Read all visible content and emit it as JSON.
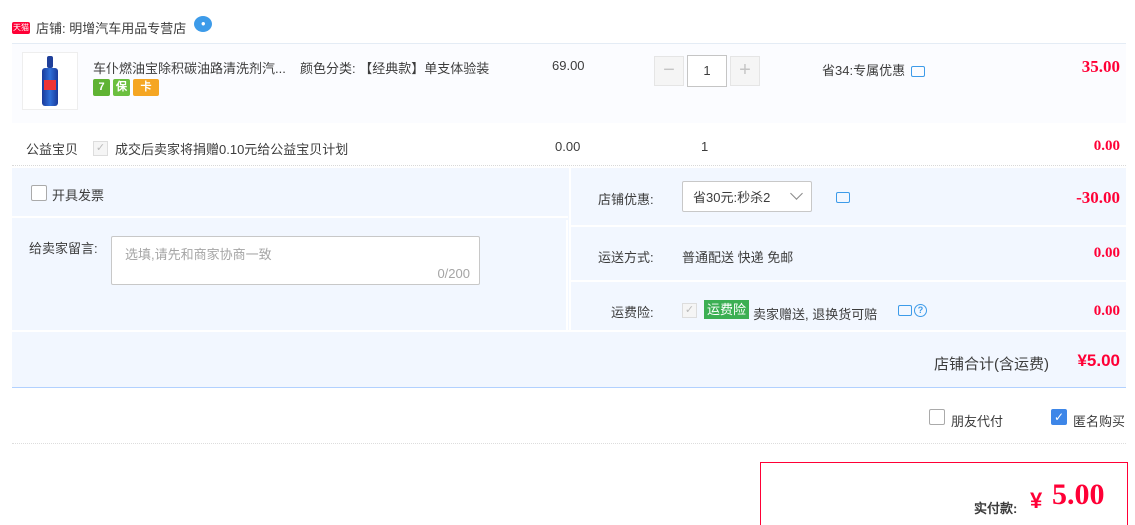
{
  "shop": {
    "badge": "天猫",
    "name": "店铺: 明增汽车用品专营店"
  },
  "item": {
    "title": "车仆燃油宝除积碳油路清洗剂汽...",
    "sku": "颜色分类: 【经典款】单支体验装",
    "tags": [
      "7",
      "保",
      "卡"
    ],
    "unit_price": "69.00",
    "qty": "1",
    "minus": "−",
    "plus": "+",
    "discount": "省34:专属优惠",
    "total": "35.00"
  },
  "charity": {
    "label": "公益宝贝",
    "text": "成交后卖家将捐赠0.10元给公益宝贝计划",
    "price": "0.00",
    "qty": "1",
    "total": "0.00"
  },
  "invoice": {
    "label": "开具发票"
  },
  "memo": {
    "label": "给卖家留言:",
    "placeholder": "选填,请先和商家协商一致",
    "count": "0/200"
  },
  "shop_discount": {
    "label": "店铺优惠:",
    "selected": "省30元:秒杀2",
    "amount": "-30.00"
  },
  "shipping": {
    "label": "运送方式:",
    "value": "普通配送 快递 免邮",
    "amount": "0.00"
  },
  "insurance": {
    "label": "运费险:",
    "badge": "运费险",
    "text": "卖家赠送, 退换货可赔",
    "amount": "0.00"
  },
  "shop_total": {
    "label": "店铺合计(含运费)",
    "amount": "¥5.00"
  },
  "options": {
    "proxy": "朋友代付",
    "anon": "匿名购买"
  },
  "pay": {
    "label": "实付款:",
    "currency": "¥",
    "amount": "5.00"
  },
  "colors": {
    "accent_red": "#ff0036",
    "panel_bg": "#f2f7ff",
    "link_blue": "#3d9be9",
    "insurance_green": "#3caf53"
  }
}
